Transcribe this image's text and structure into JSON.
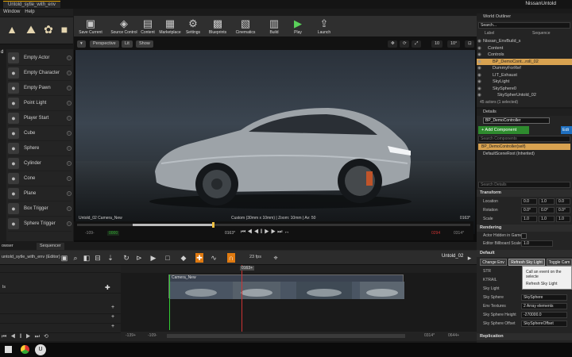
{
  "window": {
    "tab_title": "Untold_sytle_with_env",
    "project_name": "NissanUntold"
  },
  "menu": {
    "items": [
      "Window",
      "Help"
    ]
  },
  "place_panel": {
    "category_label": "d",
    "items": [
      {
        "label": "Empty Actor",
        "icon": "sphere-icon"
      },
      {
        "label": "Empty Character",
        "icon": "character-icon"
      },
      {
        "label": "Empty Pawn",
        "icon": "pawn-icon"
      },
      {
        "label": "Point Light",
        "icon": "light-icon"
      },
      {
        "label": "Player Start",
        "icon": "player-icon"
      },
      {
        "label": "Cube",
        "icon": "cube-icon"
      },
      {
        "label": "Sphere",
        "icon": "sphere-icon"
      },
      {
        "label": "Cylinder",
        "icon": "cylinder-icon"
      },
      {
        "label": "Cone",
        "icon": "cone-icon"
      },
      {
        "label": "Plane",
        "icon": "plane-icon"
      },
      {
        "label": "Box Trigger",
        "icon": "box-icon"
      },
      {
        "label": "Sphere Trigger",
        "icon": "sphere-icon"
      }
    ]
  },
  "toolbar": {
    "buttons": [
      {
        "label": "Save Current",
        "icon": "save-icon"
      },
      {
        "label": "Source Control",
        "icon": "source-control-icon"
      },
      {
        "label": "Content",
        "icon": "content-icon"
      },
      {
        "label": "Marketplace",
        "icon": "marketplace-icon"
      },
      {
        "label": "Settings",
        "icon": "gear-icon"
      },
      {
        "label": "Blueprints",
        "icon": "blueprint-icon"
      },
      {
        "label": "Cinematics",
        "icon": "clapper-icon"
      },
      {
        "label": "Build",
        "icon": "build-icon"
      },
      {
        "label": "Play",
        "icon": "play-icon"
      },
      {
        "label": "Launch",
        "icon": "launch-icon"
      }
    ]
  },
  "viewport": {
    "mode_buttons": [
      "Perspective",
      "Lit",
      "Show"
    ],
    "shot_name": "Untold_02  Camera_New",
    "camera_info": "Custom (30mm x 10mm)  |  Zoom: 10mm  |  Av: 50",
    "frame_number": "0163*",
    "scrub": {
      "start": "-109-",
      "green_marker": "0000",
      "current": "0163*",
      "red_marker": "0294",
      "end": "0314*"
    }
  },
  "sequencer": {
    "tabs": [
      "owser",
      "Sequencer"
    ],
    "sequence_name": "untold_sytle_with_env (Editor)",
    "level_name": "Untold_02",
    "fps": "23 fps",
    "tracks": [
      {
        "label": "ls"
      },
      {
        "label": ""
      },
      {
        "label": ""
      },
      {
        "label": ""
      }
    ],
    "playhead_label": "0163+",
    "clip_label": "Camera_New",
    "range_start": "-139+",
    "range_start2": "-109-",
    "range_end": "0314*",
    "range_end2": "0644+"
  },
  "outliner": {
    "title": "World Outliner",
    "search_placeholder": "Search...",
    "col_label": "Label",
    "col_type": "Sequence",
    "rows": [
      {
        "label": "Nissan_EnvBuild_s",
        "indent": 0
      },
      {
        "label": "Content",
        "indent": 1
      },
      {
        "label": "Controls",
        "indent": 1
      },
      {
        "label": "BP_DemoCont...roll_02",
        "indent": 2,
        "selected": true
      },
      {
        "label": "DummyForRef",
        "indent": 2
      },
      {
        "label": "LIT_Exhaust",
        "indent": 2
      },
      {
        "label": "SkyLight",
        "indent": 2
      },
      {
        "label": "SkySphere0",
        "indent": 2
      },
      {
        "label": "SkySpherUntold_02",
        "indent": 3
      }
    ],
    "count_text": "45 actors (1 selected)"
  },
  "details": {
    "title": "Details",
    "actor_name": "BP_DemoController",
    "add_component": "+ Add Component",
    "edit_button": "Edi",
    "search_components": "Search Components",
    "components": [
      "BP_DemoController(self)",
      "DefaultSceneRoot (Inherited)"
    ],
    "search_details": "Search Details",
    "transform_title": "Transform",
    "location_label": "Location",
    "location": [
      "0.0",
      "1.0",
      "0.0"
    ],
    "rotation_label": "Rotation",
    "rotation": [
      "0.0°",
      "0.0°",
      "0.0°"
    ],
    "scale_label": "Scale",
    "scale": [
      "1.0",
      "1.0",
      "1.0"
    ],
    "rendering_title": "Rendering",
    "hidden_label": "Actor Hidden in Game",
    "billboard_label": "Editor Billboard Scale",
    "billboard_value": "1.0",
    "default_title": "Default",
    "default_buttons": [
      "Change Env",
      "Refresh Sky Light",
      "Toggle Cam"
    ],
    "props": [
      {
        "label": "STR",
        "value": ""
      },
      {
        "label": "KTRAIL",
        "value": ""
      },
      {
        "label": "Sky Light",
        "value": ""
      },
      {
        "label": "Sky Sphere",
        "value": "SkySphere"
      },
      {
        "label": "Env Textures",
        "value": "2 Array elements"
      },
      {
        "label": "Sky Sphere Height",
        "value": "-270000.0"
      },
      {
        "label": "Sky Sphere Offset",
        "value": "SkySphereOffset"
      }
    ],
    "replication_title": "Replication"
  },
  "popup": {
    "items": [
      "Call an event on the selecte",
      "Refresh Sky Light"
    ]
  }
}
